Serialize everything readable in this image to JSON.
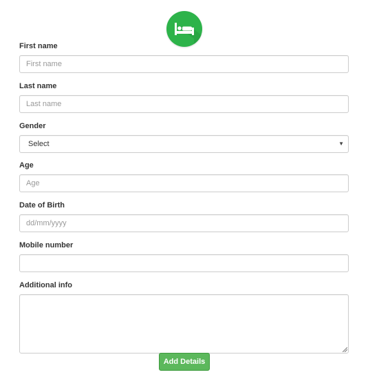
{
  "logo": {
    "icon": "bed-icon",
    "color": "#2db34a"
  },
  "form": {
    "first_name": {
      "label": "First name",
      "placeholder": "First name",
      "value": ""
    },
    "last_name": {
      "label": "Last name",
      "placeholder": "Last name",
      "value": ""
    },
    "gender": {
      "label": "Gender",
      "selected": "Select"
    },
    "age": {
      "label": "Age",
      "placeholder": "Age",
      "value": ""
    },
    "dob": {
      "label": "Date of Birth",
      "placeholder": "dd/mm/yyyy",
      "value": ""
    },
    "mobile": {
      "label": "Mobile number",
      "placeholder": "",
      "value": ""
    },
    "additional_info": {
      "label": "Additional info",
      "value": ""
    }
  },
  "submit": {
    "label": "Add Details",
    "color": "#5cb85c"
  }
}
